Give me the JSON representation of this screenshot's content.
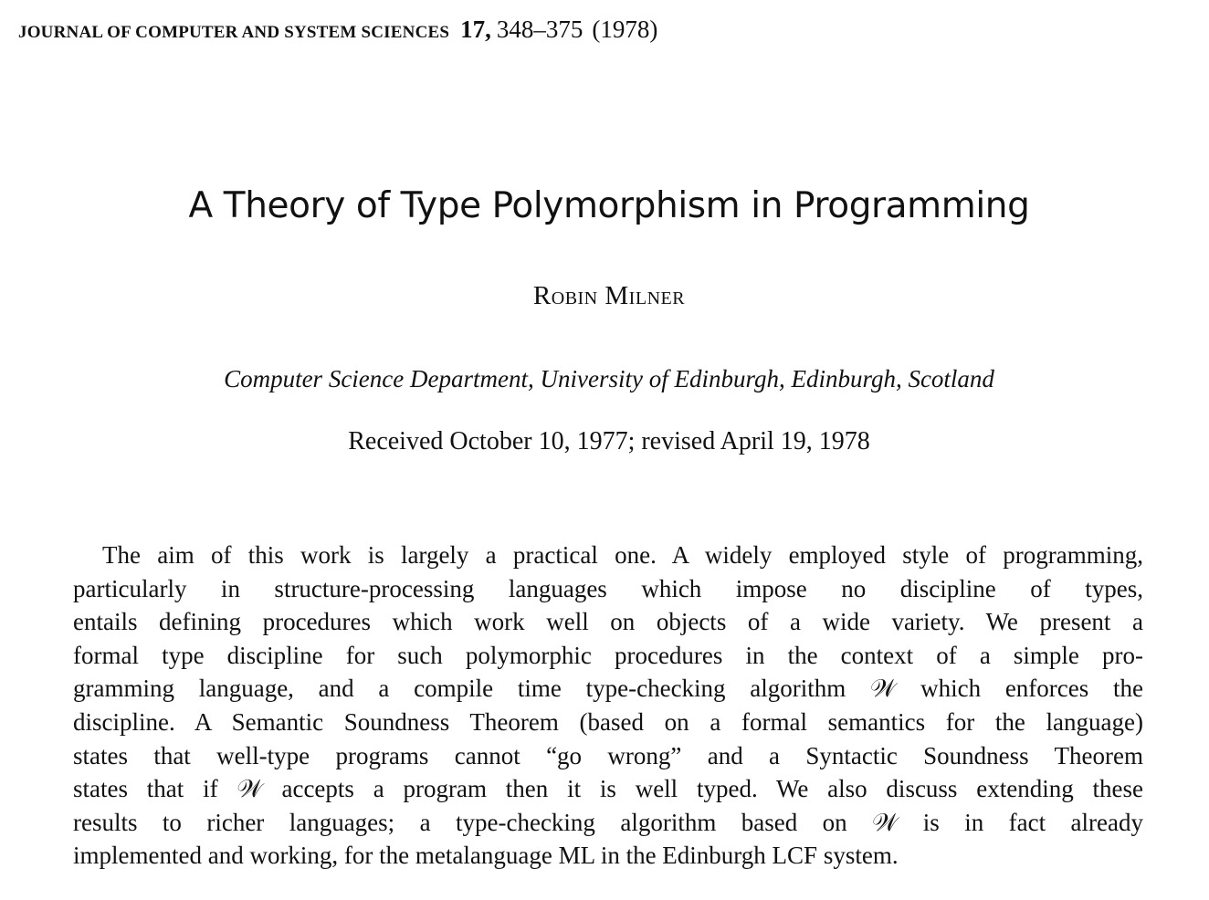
{
  "header": {
    "journal": "JOURNAL OF COMPUTER AND SYSTEM SCIENCES",
    "volume": "17,",
    "pages": "348–375",
    "year": "(1978)"
  },
  "title": "A Theory of Type Polymorphism in Programming",
  "author": "Robin Milner",
  "affiliation": "Computer Science Department, University of Edinburgh, Edinburgh, Scotland",
  "received": "Received October 10, 1977; revised April 19, 1978",
  "abstract": {
    "lines": [
      "The aim of this work is largely a practical one. A widely employed style of programming,",
      "particularly in structure-processing languages which impose no discipline of types,",
      "entails defining procedures which work well on objects of a wide variety. We present a",
      "formal type discipline for such polymorphic procedures in the context of a simple pro-",
      "gramming language, and a compile time type-checking algorithm 𝒲 which enforces the",
      "discipline. A Semantic Soundness Theorem (based on a formal semantics for the language)",
      "states that well-type programs cannot “go wrong” and a Syntactic Soundness Theorem",
      "states that if 𝒲 accepts a program then it is well typed. We also discuss extending these",
      "results to richer languages; a type-checking algorithm based on 𝒲 is in fact already",
      "implemented and working, for the metalanguage ML in the Edinburgh LCF system."
    ]
  }
}
